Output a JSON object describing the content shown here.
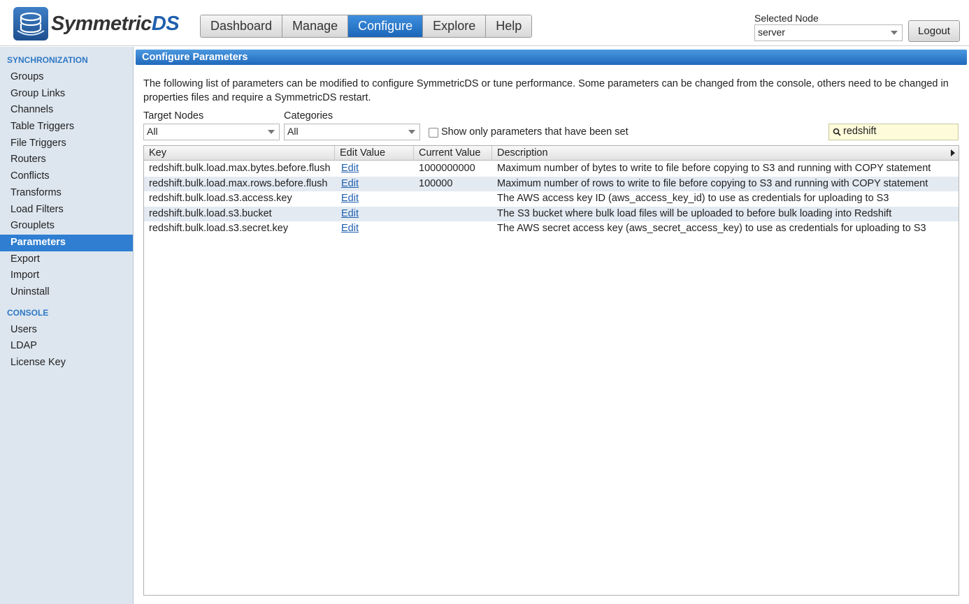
{
  "app": {
    "logo_text_main": "Symmetric",
    "logo_text_accent": "DS",
    "brand_color": "#1f5fae",
    "accent_color": "#2f7ed1"
  },
  "topnav": {
    "tabs": [
      {
        "label": "Dashboard",
        "active": false
      },
      {
        "label": "Manage",
        "active": false
      },
      {
        "label": "Configure",
        "active": true
      },
      {
        "label": "Explore",
        "active": false
      },
      {
        "label": "Help",
        "active": false
      }
    ]
  },
  "node": {
    "label": "Selected Node",
    "value": "server",
    "logout_label": "Logout"
  },
  "sidebar": {
    "sections": [
      {
        "title": "SYNCHRONIZATION",
        "items": [
          "Groups",
          "Group Links",
          "Channels",
          "Table Triggers",
          "File Triggers",
          "Routers",
          "Conflicts",
          "Transforms",
          "Load Filters",
          "Grouplets",
          "Parameters",
          "Export",
          "Import",
          "Uninstall"
        ]
      },
      {
        "title": "CONSOLE",
        "items": [
          "Users",
          "LDAP",
          "License Key"
        ]
      }
    ],
    "active_item": "Parameters"
  },
  "main": {
    "panel_title": "Configure Parameters",
    "intro": "The following list of parameters can be modified to configure SymmetricDS or tune performance. Some parameters can be changed from the console, others need to be changed in properties files and require a SymmetricDS restart.",
    "filters": {
      "target_nodes_label": "Target Nodes",
      "target_nodes_value": "All",
      "categories_label": "Categories",
      "categories_value": "All",
      "show_set_label": "Show only parameters that have been set",
      "show_set_checked": false,
      "search_value": "redshift"
    },
    "grid": {
      "columns": [
        "Key",
        "Edit Value",
        "Current Value",
        "Description"
      ],
      "rows": [
        {
          "key": "redshift.bulk.load.max.bytes.before.flush",
          "edit": "Edit",
          "current": "1000000000",
          "description": "Maximum number of bytes to write to file before copying to S3 and running with COPY statement"
        },
        {
          "key": "redshift.bulk.load.max.rows.before.flush",
          "edit": "Edit",
          "current": "100000",
          "description": "Maximum number of rows to write to file before copying to S3 and running with COPY statement"
        },
        {
          "key": "redshift.bulk.load.s3.access.key",
          "edit": "Edit",
          "current": "",
          "description": "The AWS access key ID (aws_access_key_id) to use as credentials for uploading to S3"
        },
        {
          "key": "redshift.bulk.load.s3.bucket",
          "edit": "Edit",
          "current": "",
          "description": "The S3 bucket where bulk load files will be uploaded to before bulk loading into Redshift"
        },
        {
          "key": "redshift.bulk.load.s3.secret.key",
          "edit": "Edit",
          "current": "",
          "description": "The AWS secret access key (aws_secret_access_key) to use as credentials for uploading to S3"
        }
      ]
    }
  }
}
